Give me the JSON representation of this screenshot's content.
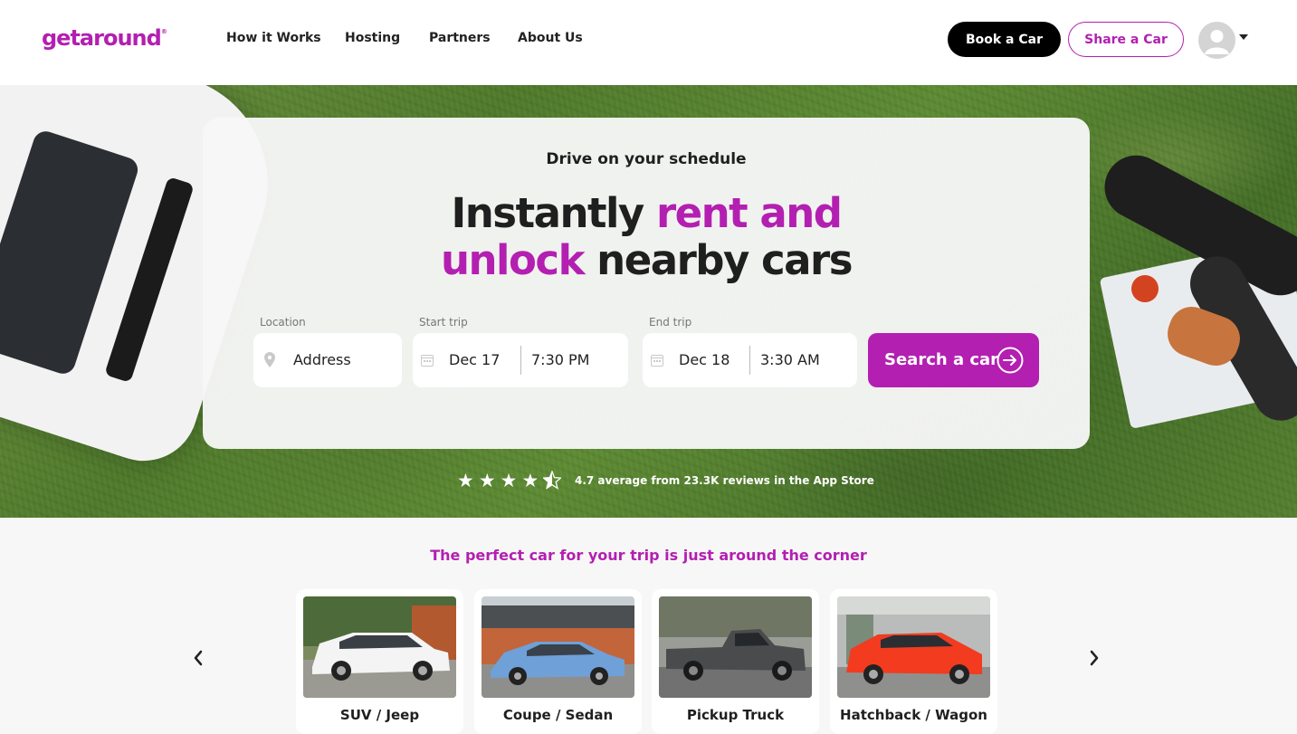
{
  "brand": {
    "logo": "getaround",
    "logo_mark": "®",
    "accent_color": "#b31fb1"
  },
  "nav": {
    "links": [
      "How it Works",
      "Hosting",
      "Partners",
      "About Us"
    ],
    "book_label": "Book a Car",
    "share_label": "Share a Car"
  },
  "hero": {
    "subtitle": "Drive on your schedule",
    "title_part1": "Instantly ",
    "title_accent1": "rent and",
    "title_accent2": "unlock",
    "title_part2": " nearby cars",
    "location_label": "Location",
    "location_placeholder": "Address",
    "start_label": "Start trip",
    "start_date": "Dec 17",
    "start_time": "7:30 PM",
    "end_label": "End trip",
    "end_date": "Dec 18",
    "end_time": "3:30 AM",
    "search_label": "Search a car"
  },
  "rating": {
    "stars": 4.5,
    "text": "4.7 average from 23.3K reviews in the App Store"
  },
  "categories": {
    "tagline": "The perfect car for your trip is just around the corner",
    "items": [
      {
        "label": "SUV / Jeep",
        "car_color": "#f4f4f4"
      },
      {
        "label": "Coupe / Sedan",
        "car_color": "#6fa0d8"
      },
      {
        "label": "Pickup Truck",
        "car_color": "#4a4b4d"
      },
      {
        "label": "Hatchback / Wagon",
        "car_color": "#f23b1f"
      }
    ]
  }
}
